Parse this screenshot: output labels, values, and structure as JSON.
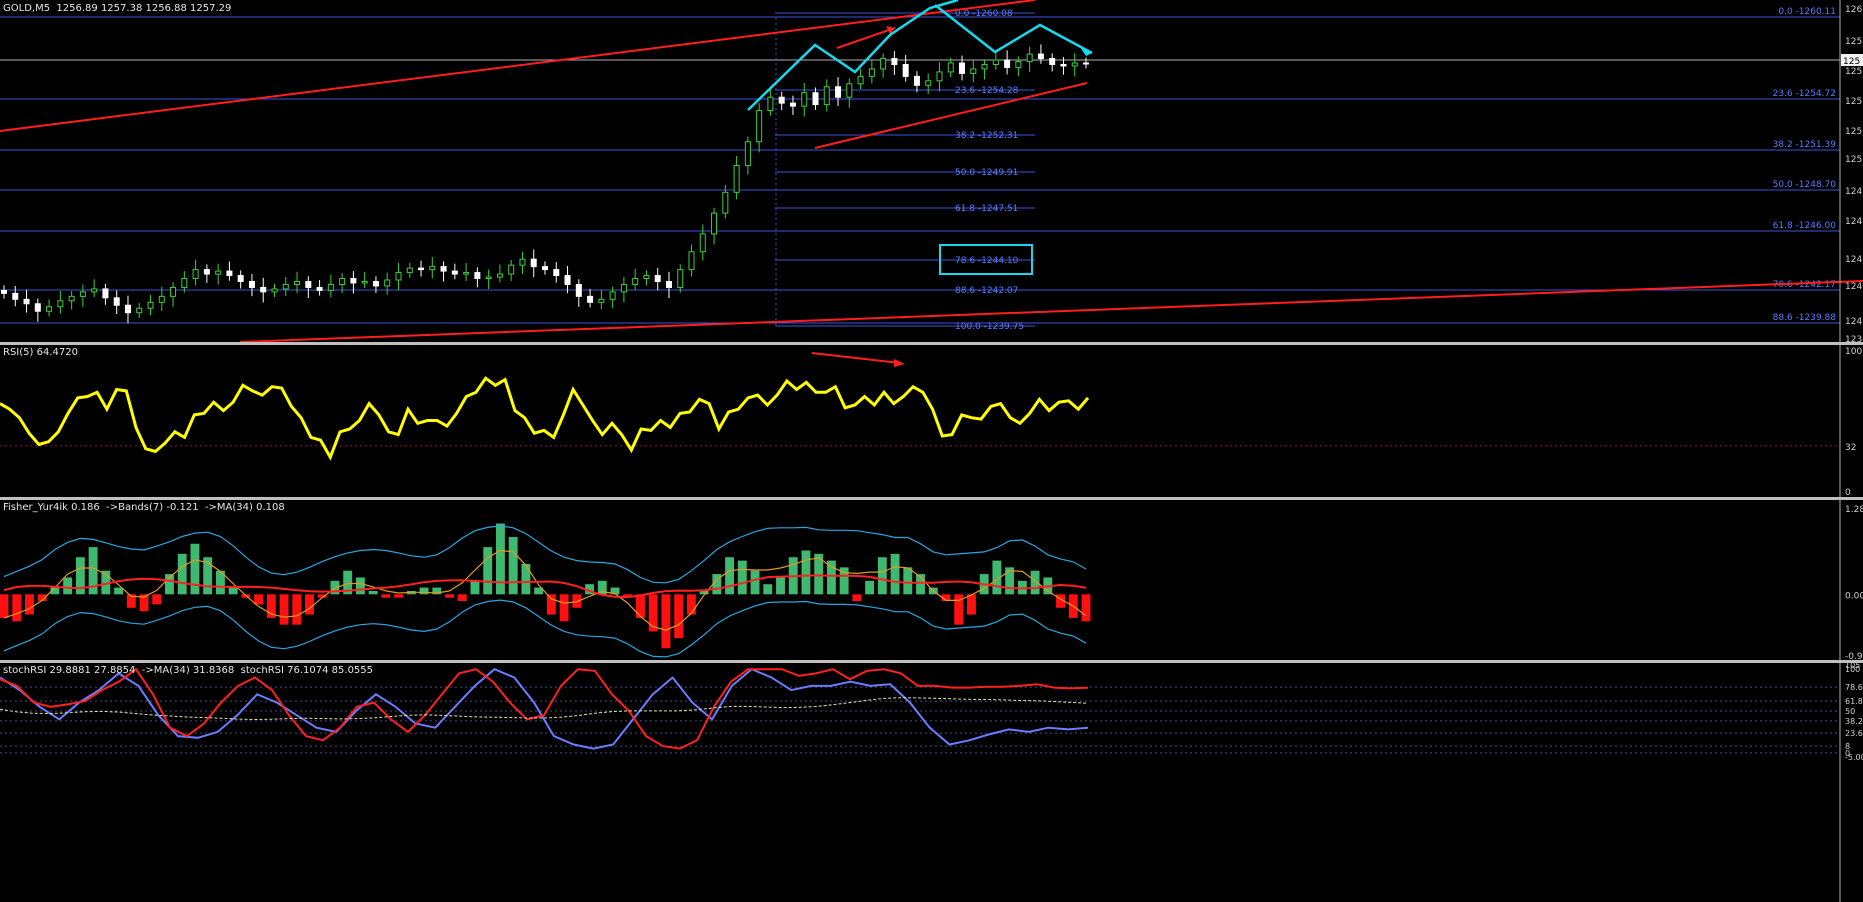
{
  "main": {
    "header": "GOLD,M5  1256.89 1257.38 1256.88 1257.29",
    "axis_ticks": [
      "126",
      "125",
      "125",
      "125",
      "125",
      "125",
      "124",
      "124",
      "124",
      "124",
      "124",
      "123"
    ],
    "fib_left": [
      "0.0 -1260.08",
      "23.6 -1254.28",
      "38.2 -1252.31",
      "50.0 -1249.91",
      "61.8 -1247.51",
      "78.6 -1244.10",
      "88.6 -1242.07",
      "100.0 -1239.75"
    ],
    "fib_right": [
      "0.0 -1260.11",
      "23.6 -1254.72",
      "38.2 -1251.39",
      "50.0 -1248.70",
      "61.8 -1246.00",
      "70.6 -1242.17",
      "88.6 -1239.88"
    ]
  },
  "rsi": {
    "header": "RSI(5) 64.4720",
    "ticks": [
      "100",
      "32",
      "0"
    ]
  },
  "fisher": {
    "header": "Fisher_Yur4ik 0.186  ->Bands(7) -0.121  ->MA(34) 0.108",
    "ticks": [
      "1.28",
      "0.00",
      "-0.9"
    ]
  },
  "stoch": {
    "header": "stochRSI 29.8881 27.8854  ->MA(34) 31.8368  stochRSI 76.1074 85.0555",
    "ticks": [
      "105",
      "100",
      "78.6",
      "61.8",
      "50",
      "38.2",
      "23.6",
      "8",
      "0",
      "-5.00"
    ]
  },
  "colors": {
    "bull": "#3ad03a",
    "bear": "#ffffff",
    "fib": "#3b53d9",
    "trend": "#ff1e1e",
    "arrow": "#18d8f0",
    "rsi": "#ffff00",
    "hist_up": "#3fb870",
    "hist_dn": "#ff1010",
    "band": "#2aa7e0",
    "ma_orange": "#e39a24",
    "stoch_red": "#ff2020",
    "stoch_blue": "#6b7cff"
  },
  "chart_data": [
    {
      "type": "candlestick",
      "title": "GOLD,M5",
      "ylim": [
        1239,
        1261
      ],
      "close": [
        1241.8,
        1241.4,
        1241.1,
        1240.6,
        1240.9,
        1241.3,
        1241.6,
        1241.9,
        1242.1,
        1241.5,
        1241.0,
        1240.5,
        1240.8,
        1241.2,
        1241.6,
        1242.2,
        1242.8,
        1243.4,
        1243.1,
        1243.3,
        1243.0,
        1242.6,
        1242.2,
        1241.9,
        1242.1,
        1242.4,
        1242.6,
        1242.2,
        1242.0,
        1242.4,
        1242.8,
        1242.5,
        1242.6,
        1242.3,
        1242.7,
        1243.2,
        1243.5,
        1243.4,
        1243.6,
        1243.3,
        1243.1,
        1243.2,
        1242.8,
        1242.9,
        1243.1,
        1243.7,
        1244.1,
        1243.6,
        1243.4,
        1243.0,
        1242.4,
        1241.6,
        1241.2,
        1241.4,
        1241.9,
        1242.4,
        1242.8,
        1243.0,
        1242.6,
        1242.2,
        1243.4,
        1244.6,
        1245.8,
        1247.2,
        1248.6,
        1250.4,
        1252.0,
        1254.1,
        1255.0,
        1254.6,
        1254.4,
        1255.3,
        1254.5,
        1255.7,
        1255.0,
        1255.9,
        1256.4,
        1256.9,
        1257.6,
        1257.2,
        1256.4,
        1255.8,
        1256.1,
        1256.7,
        1257.3,
        1256.6,
        1256.9,
        1257.2,
        1257.5,
        1257.0,
        1257.4,
        1257.9,
        1257.6,
        1257.2,
        1257.1,
        1257.3,
        1257.29
      ]
    },
    {
      "type": "line",
      "title": "RSI(5)",
      "ylim": [
        0,
        100
      ],
      "values": [
        62,
        58,
        52,
        41,
        33,
        35,
        42,
        55,
        66,
        67,
        70,
        58,
        72,
        71,
        45,
        30,
        28,
        34,
        42,
        38,
        54,
        55,
        63,
        57,
        63,
        75,
        71,
        68,
        74,
        73,
        60,
        52,
        38,
        36,
        24,
        42,
        44,
        50,
        62,
        54,
        42,
        40,
        58,
        48,
        50,
        50,
        46,
        55,
        67,
        70,
        80,
        75,
        79,
        57,
        52,
        41,
        43,
        38,
        54,
        72,
        61,
        50,
        40,
        48,
        40,
        29,
        44,
        43,
        50,
        45,
        55,
        56,
        65,
        62,
        44,
        56,
        58,
        66,
        68,
        61,
        68,
        78,
        72,
        77,
        70,
        70,
        74,
        59,
        61,
        67,
        61,
        70,
        62,
        67,
        74,
        70,
        58,
        39,
        40,
        54,
        52,
        51,
        60,
        62,
        52,
        48,
        55,
        65,
        57,
        63,
        64,
        58,
        66
      ]
    },
    {
      "type": "bar",
      "title": "Fisher_Yur4ik",
      "ylim": [
        -0.9,
        1.28
      ],
      "values": [
        -0.35,
        -0.4,
        -0.3,
        -0.1,
        0.1,
        0.25,
        0.55,
        0.7,
        0.35,
        0.1,
        -0.2,
        -0.25,
        -0.15,
        0.3,
        0.6,
        0.75,
        0.55,
        0.35,
        0.1,
        -0.05,
        -0.15,
        -0.35,
        -0.45,
        -0.45,
        -0.3,
        -0.05,
        0.2,
        0.35,
        0.25,
        0.05,
        -0.05,
        -0.05,
        0.05,
        0.1,
        0.1,
        -0.05,
        -0.1,
        0.2,
        0.7,
        1.05,
        0.85,
        0.45,
        0.1,
        -0.3,
        -0.4,
        -0.2,
        0.15,
        0.2,
        0.1,
        -0.05,
        -0.35,
        -0.55,
        -0.8,
        -0.65,
        -0.3,
        0.05,
        0.3,
        0.55,
        0.5,
        0.35,
        0.15,
        0.25,
        0.55,
        0.65,
        0.6,
        0.5,
        0.4,
        -0.1,
        0.2,
        0.55,
        0.6,
        0.4,
        0.3,
        0.1,
        -0.1,
        -0.45,
        -0.3,
        0.3,
        0.5,
        0.4,
        0.2,
        0.35,
        0.25,
        -0.2,
        -0.35,
        -0.4
      ]
    },
    {
      "type": "line",
      "title": "stochRSI",
      "ylim": [
        -5,
        105
      ],
      "series": [
        {
          "name": "stochRSI",
          "values": [
            88,
            80,
            60,
            55,
            58,
            62,
            75,
            85,
            100,
            70,
            30,
            20,
            35,
            60,
            80,
            90,
            75,
            45,
            20,
            15,
            30,
            55,
            60,
            40,
            25,
            45,
            70,
            95,
            100,
            85,
            60,
            40,
            45,
            80,
            100,
            98,
            70,
            50,
            20,
            8,
            5,
            15,
            55,
            85,
            100,
            100,
            100,
            92,
            95,
            100,
            88,
            98,
            100,
            95,
            80,
            80,
            78,
            78,
            79,
            79,
            80,
            82,
            78,
            77,
            78
          ]
        },
        {
          "name": "stochRSI",
          "values": [
            90,
            75,
            55,
            40,
            60,
            75,
            95,
            80,
            45,
            20,
            18,
            25,
            45,
            70,
            60,
            45,
            30,
            25,
            50,
            70,
            55,
            35,
            30,
            55,
            80,
            100,
            90,
            60,
            20,
            10,
            5,
            10,
            40,
            70,
            90,
            60,
            40,
            80,
            100,
            90,
            75,
            80,
            80,
            85,
            80,
            82,
            60,
            30,
            10,
            15,
            22,
            28,
            25,
            30,
            28,
            30
          ]
        }
      ]
    }
  ]
}
